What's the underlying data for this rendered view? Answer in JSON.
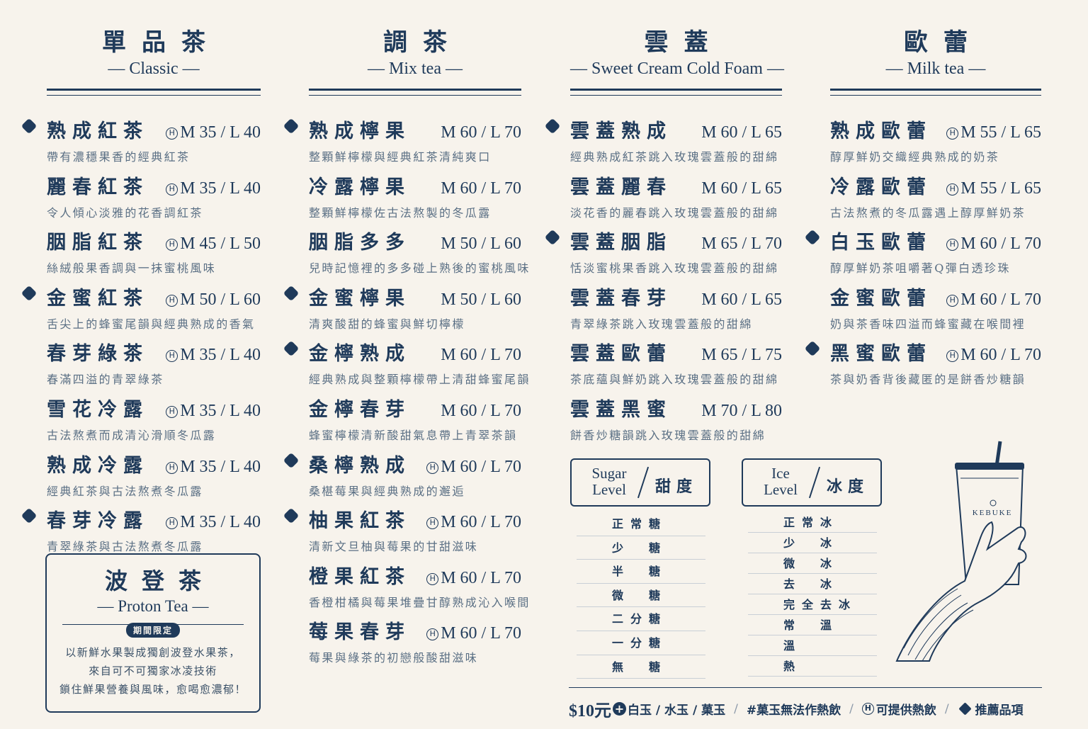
{
  "columns": [
    {
      "title": "單品茶",
      "subtitle": "— Classic —",
      "items": [
        {
          "name": "熟成紅茶",
          "hot": true,
          "price": "M 35 / L 40",
          "desc": "帶有濃穩果香的經典紅茶",
          "rec": true
        },
        {
          "name": "麗春紅茶",
          "hot": true,
          "price": "M 35 / L 40",
          "desc": "令人傾心淡雅的花香調紅茶",
          "rec": false
        },
        {
          "name": "胭脂紅茶",
          "hot": true,
          "price": "M 45 / L 50",
          "desc": "絲絨般果香調與一抹蜜桃風味",
          "rec": false
        },
        {
          "name": "金蜜紅茶",
          "hot": true,
          "price": "M 50 / L 60",
          "desc": "舌尖上的蜂蜜尾韻與經典熟成的香氣",
          "rec": true
        },
        {
          "name": "春芽綠茶",
          "hot": true,
          "price": "M 35 / L 40",
          "desc": "春滿四溢的青翠綠茶",
          "rec": false
        },
        {
          "name": "雪花冷露",
          "hot": true,
          "price": "M 35 / L 40",
          "desc": "古法熬煮而成清沁滑順冬瓜露",
          "rec": false
        },
        {
          "name": "熟成冷露",
          "hot": true,
          "price": "M 35 / L 40",
          "desc": "經典紅茶與古法熬煮冬瓜露",
          "rec": false
        },
        {
          "name": "春芽冷露",
          "hot": true,
          "price": "M 35 / L 40",
          "desc": "青翠綠茶與古法熬煮冬瓜露",
          "rec": true
        }
      ]
    },
    {
      "title": "調茶",
      "subtitle": "— Mix tea —",
      "items": [
        {
          "name": "熟成檸果",
          "hot": false,
          "price": "M 60 / L 70",
          "desc": "整顆鮮檸檬與經典紅茶清純爽口",
          "rec": true
        },
        {
          "name": "冷露檸果",
          "hot": false,
          "price": "M 60 / L 70",
          "desc": "整顆鮮檸檬佐古法熬製的冬瓜露",
          "rec": false
        },
        {
          "name": "胭脂多多",
          "hot": false,
          "price": "M 50 / L 60",
          "desc": "兒時記憶裡的多多碰上熟後的蜜桃風味",
          "rec": false
        },
        {
          "name": "金蜜檸果",
          "hot": false,
          "price": "M 50 / L 60",
          "desc": "清爽酸甜的蜂蜜與鮮切檸檬",
          "rec": true
        },
        {
          "name": "金檸熟成",
          "hot": false,
          "price": "M 60 / L 70",
          "desc": "經典熟成與整顆檸檬帶上清甜蜂蜜尾韻",
          "rec": true
        },
        {
          "name": "金檸春芽",
          "hot": false,
          "price": "M 60 / L 70",
          "desc": "蜂蜜檸檬清新酸甜氣息帶上青翠茶韻",
          "rec": false
        },
        {
          "name": "桑檸熟成",
          "hot": true,
          "price": "M 60 / L 70",
          "desc": "桑椹莓果與經典熟成的邂逅",
          "rec": true
        },
        {
          "name": "柚果紅茶",
          "hot": true,
          "price": "M 60 / L 70",
          "desc": "清新文旦柚與莓果的甘甜滋味",
          "rec": true
        },
        {
          "name": "橙果紅茶",
          "hot": true,
          "price": "M 60 / L 70",
          "desc": "香橙柑橘與莓果堆疊甘醇熟成沁入喉間",
          "rec": false
        },
        {
          "name": "莓果春芽",
          "hot": true,
          "price": "M 60 / L 70",
          "desc": "莓果與綠茶的初戀般酸甜滋味",
          "rec": false
        }
      ]
    },
    {
      "title": "雲蓋",
      "subtitle": "— Sweet Cream Cold Foam —",
      "items": [
        {
          "name": "雲蓋熟成",
          "hot": false,
          "price": "M 60 / L 65",
          "desc": "經典熟成紅茶跳入玫瑰雲蓋般的甜綿",
          "rec": true
        },
        {
          "name": "雲蓋麗春",
          "hot": false,
          "price": "M 60 / L 65",
          "desc": "淡花香的麗春跳入玫瑰雲蓋般的甜綿",
          "rec": false
        },
        {
          "name": "雲蓋胭脂",
          "hot": false,
          "price": "M 65 / L 70",
          "desc": "恬淡蜜桃果香跳入玫瑰雲蓋般的甜綿",
          "rec": true
        },
        {
          "name": "雲蓋春芽",
          "hot": false,
          "price": "M 60 / L 65",
          "desc": "青翠綠茶跳入玫瑰雲蓋般的甜綿",
          "rec": false
        },
        {
          "name": "雲蓋歐蕾",
          "hot": false,
          "price": "M 65 / L 75",
          "desc": "茶底蘊與鮮奶跳入玫瑰雲蓋般的甜綿",
          "rec": false
        },
        {
          "name": "雲蓋黑蜜",
          "hot": false,
          "price": "M 70 / L 80",
          "desc": "餅香炒糖韻跳入玫瑰雲蓋般的甜綿",
          "rec": false
        }
      ]
    },
    {
      "title": "歐蕾",
      "subtitle": "— Milk tea —",
      "items": [
        {
          "name": "熟成歐蕾",
          "hot": true,
          "price": "M 55 / L 65",
          "desc": "醇厚鮮奶交織經典熟成的奶茶",
          "rec": false
        },
        {
          "name": "冷露歐蕾",
          "hot": true,
          "price": "M 55 / L 65",
          "desc": "古法熬煮的冬瓜露遇上醇厚鮮奶茶",
          "rec": false
        },
        {
          "name": "白玉歐蕾",
          "hot": true,
          "price": "M 60 / L 70",
          "desc": "醇厚鮮奶茶咀嚼著Q彈白透珍珠",
          "rec": true
        },
        {
          "name": "金蜜歐蕾",
          "hot": true,
          "price": "M 60 / L 70",
          "desc": "奶與茶香味四溢而蜂蜜藏在喉間裡",
          "rec": false
        },
        {
          "name": "黑蜜歐蕾",
          "hot": true,
          "price": "M 60 / L 70",
          "desc": "茶與奶香背後藏匿的是餅香炒糖韻",
          "rec": true
        }
      ]
    }
  ],
  "proton": {
    "title": "波登茶",
    "subtitle": "— Proton Tea —",
    "badge": "期間限定",
    "desc1": "以新鮮水果製成獨創波登水果茶，",
    "desc2": "來自可不可獨家冰凌技術",
    "desc3": "鎖住鮮果營養與風味，愈喝愈濃郁！"
  },
  "sugar": {
    "en1": "Sugar",
    "en2": "Level",
    "zh": "甜度",
    "options": [
      "正常糖",
      "少　糖",
      "半　糖",
      "微　糖",
      "二分糖",
      "一分糖",
      "無　糖"
    ]
  },
  "ice": {
    "en1": "Ice",
    "en2": "Level",
    "zh": "冰度",
    "options": [
      "正常冰",
      "少　冰",
      "微　冰",
      "去　冰",
      "完全去冰",
      "常　溫",
      "溫",
      "熱"
    ]
  },
  "footer": {
    "price": "$10元",
    "toppings": "白玉 / 水玉 / 菓玉",
    "note": "#菓玉無法作熱飲",
    "hot_label": "可提供熱飲",
    "rec_label": "推薦品項"
  },
  "cup": {
    "brand": "KEBUKE"
  },
  "icons": {
    "hot": "circled-h-icon",
    "recommended": "diamond-icon",
    "add": "plus-circle-icon"
  },
  "colors": {
    "ink": "#1f3a5a",
    "background": "#f7f3ec"
  }
}
